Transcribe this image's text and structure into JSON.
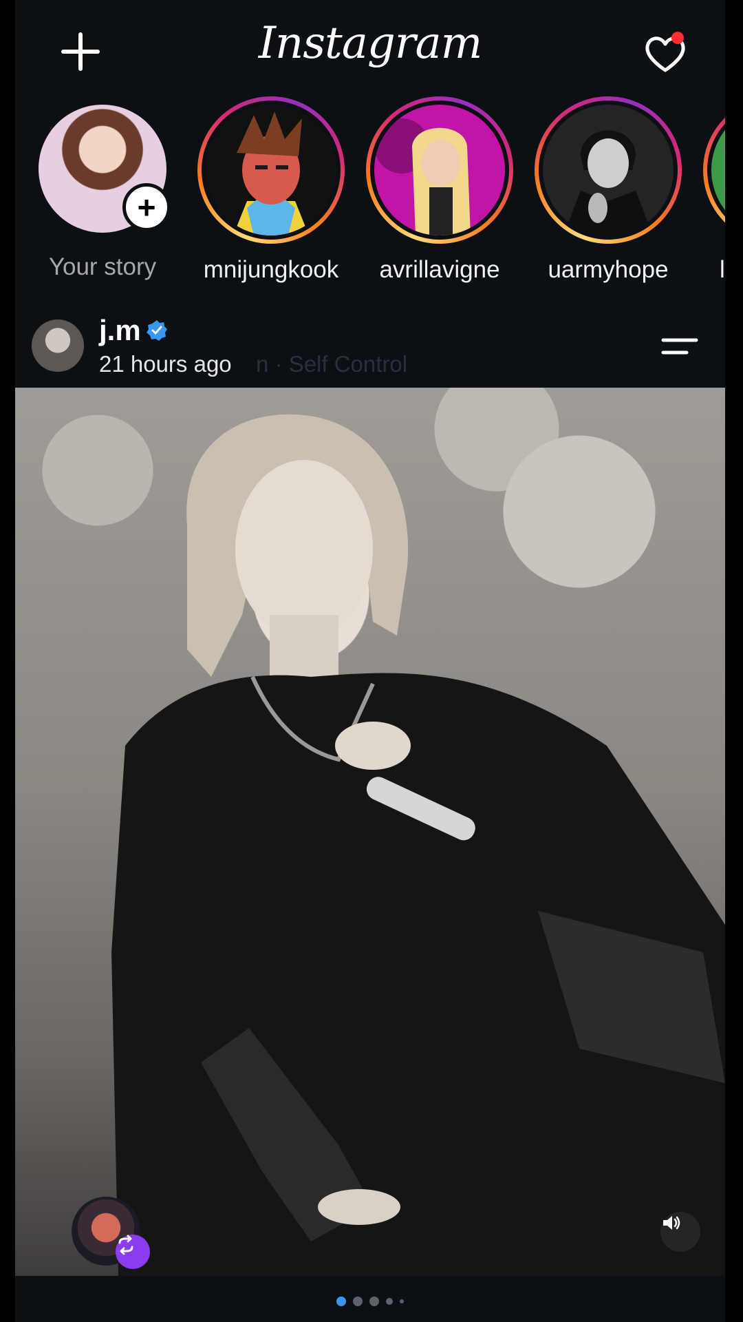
{
  "app": {
    "title": "Instagram"
  },
  "topbar": {
    "create_icon": "plus-icon",
    "activity_icon": "heart-icon",
    "has_notification": true
  },
  "stories": [
    {
      "label": "Your story",
      "own": true
    },
    {
      "label": "mnijungkook"
    },
    {
      "label": "avrillavigne"
    },
    {
      "label": "uarmyhope"
    },
    {
      "label": "lo"
    }
  ],
  "post": {
    "username": "j.m",
    "verified": true,
    "time": "21 hours ago",
    "audio_hint": "n · Self Control",
    "media_count": 5,
    "active_index": 0
  },
  "colors": {
    "background": "#0c0f14",
    "accent": "#3897f0",
    "badge": "#8b3cf0",
    "notification": "#ff2d2d"
  }
}
